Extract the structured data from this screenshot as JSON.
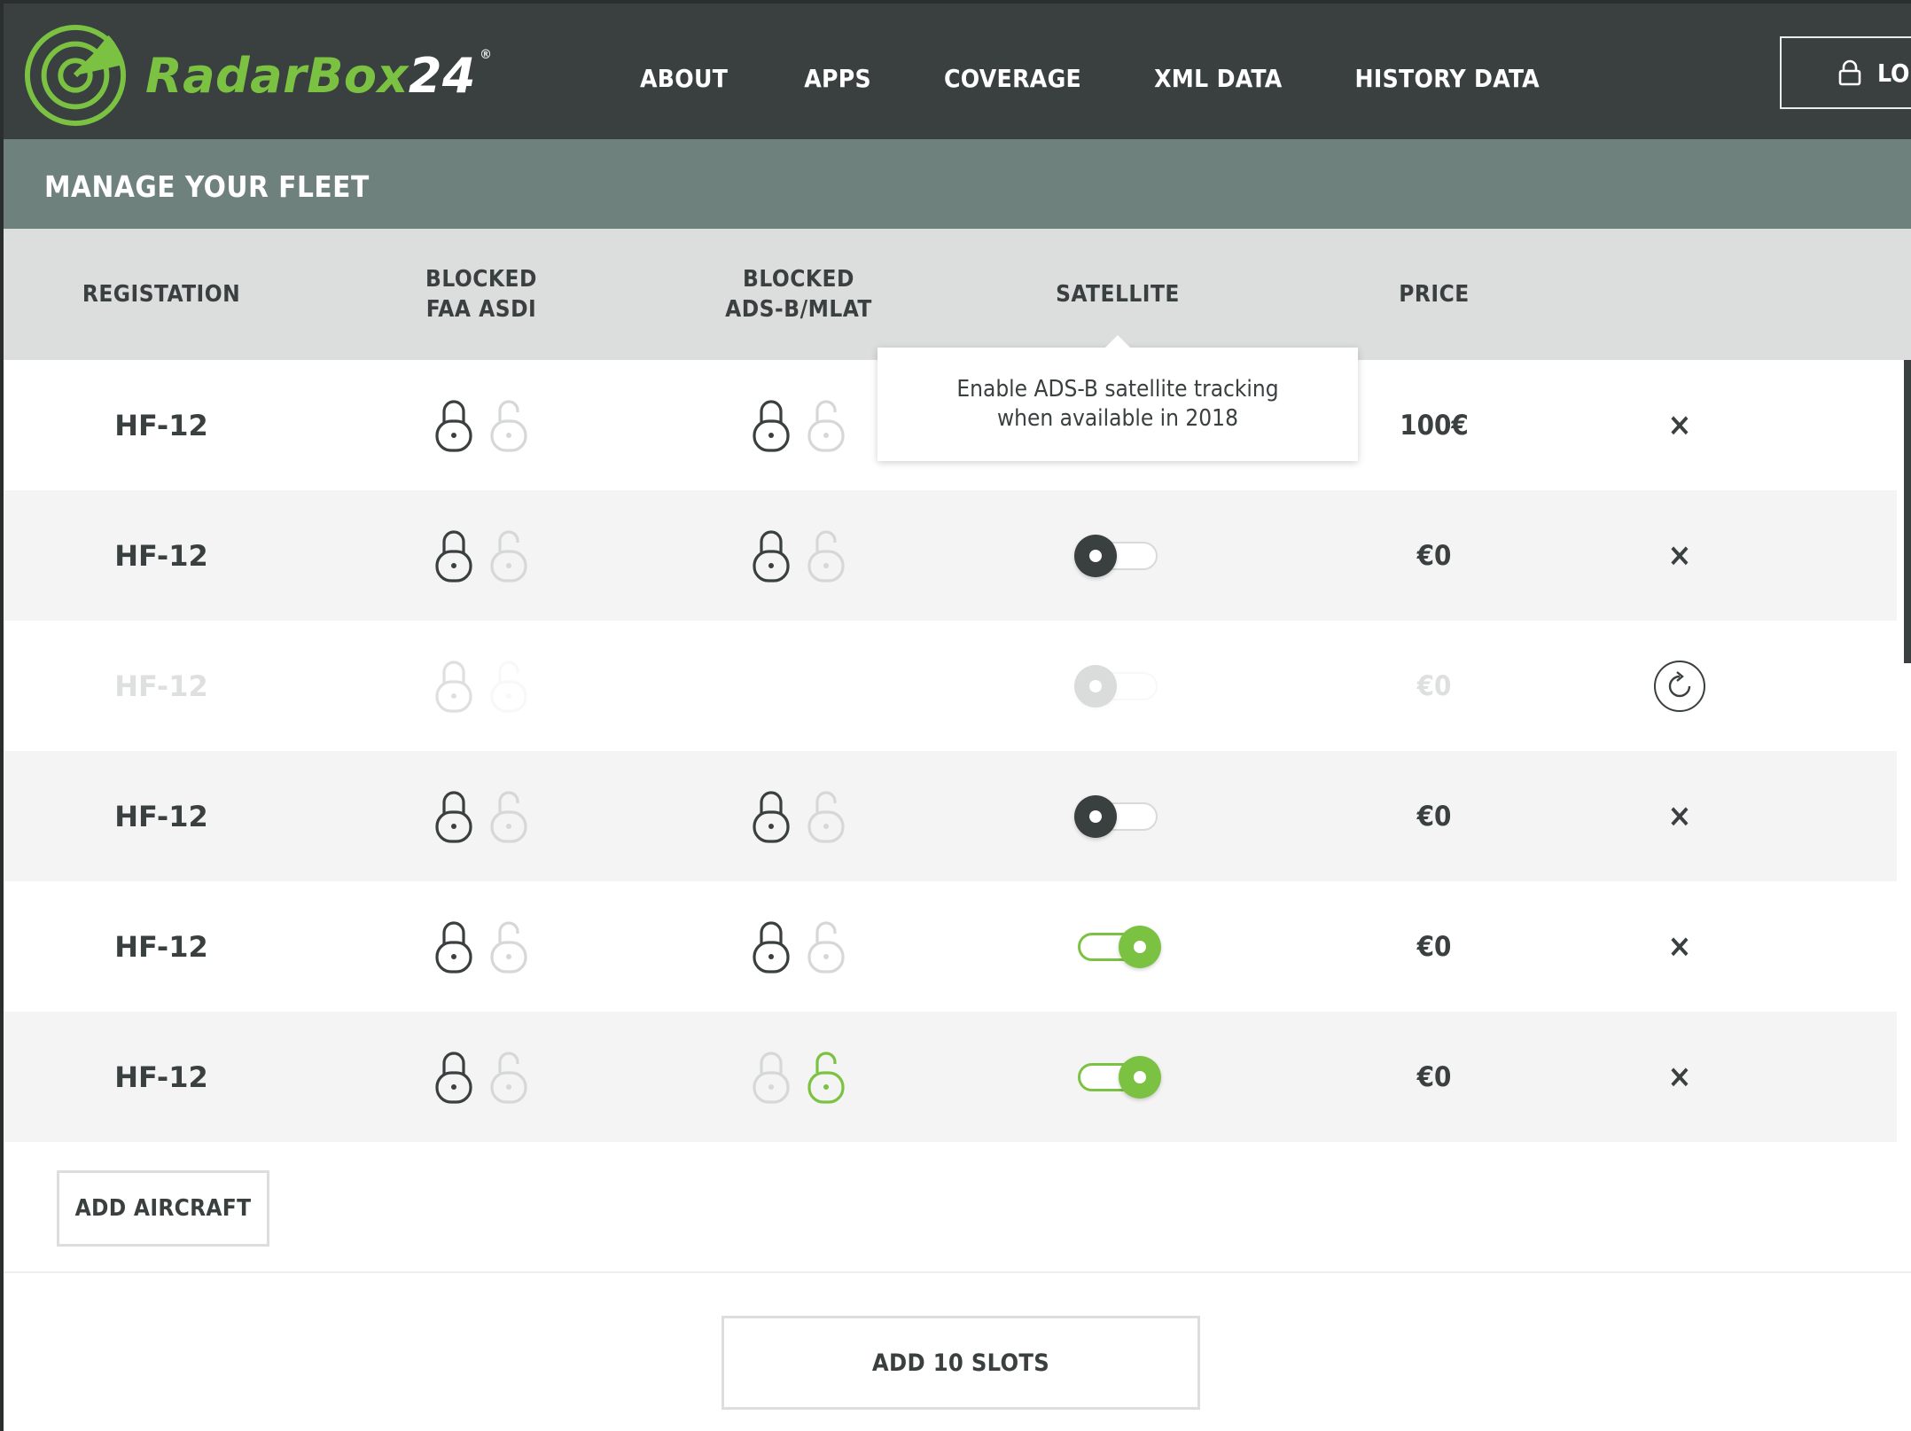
{
  "app": {
    "logo_main": "RadarBox",
    "logo_num": "24",
    "logo_mark": "®",
    "brand_color": "#7cc242"
  },
  "nav": {
    "items": [
      "ABOUT",
      "APPS",
      "COVERAGE",
      "XML DATA",
      "HISTORY DATA"
    ],
    "login_label": "LO",
    "login_icon": "lock-icon"
  },
  "page": {
    "title": "MANAGE YOUR FLEET"
  },
  "table": {
    "headers": {
      "registration": "REGISTATION",
      "blocked_faa_1": "BLOCKED",
      "blocked_faa_2": "FAA ASDI",
      "blocked_adsb_1": "BLOCKED",
      "blocked_adsb_2": "ADS-B/MLAT",
      "satellite": "SATELLITE",
      "price": "PRICE"
    },
    "rows": [
      {
        "registration": "HF-12",
        "price": "100€",
        "satellite": "hidden",
        "faa": "locked",
        "adsb": "locked",
        "action": "remove",
        "action_label": "×"
      },
      {
        "registration": "HF-12",
        "price": "€0",
        "satellite": "off",
        "faa": "locked",
        "adsb": "locked",
        "action": "remove",
        "action_label": "×"
      },
      {
        "registration": "HF-12",
        "price": "€0",
        "satellite": "disabled",
        "faa": "locked",
        "adsb": "none",
        "action": "restore",
        "action_label": ""
      },
      {
        "registration": "HF-12",
        "price": "€0",
        "satellite": "off",
        "faa": "locked",
        "adsb": "locked",
        "action": "remove",
        "action_label": "×"
      },
      {
        "registration": "HF-12",
        "price": "€0",
        "satellite": "on",
        "faa": "locked",
        "adsb": "locked",
        "action": "remove",
        "action_label": "×"
      },
      {
        "registration": "HF-12",
        "price": "€0",
        "satellite": "on",
        "faa": "locked",
        "adsb": "unlocked",
        "action": "remove",
        "action_label": "×"
      }
    ]
  },
  "tooltip": {
    "line1": "Enable ADS-B satellite tracking",
    "line2": "when available in 2018"
  },
  "buttons": {
    "add_aircraft": "ADD AIRCRAFT",
    "add_slots": "ADD 10 SLOTS"
  }
}
